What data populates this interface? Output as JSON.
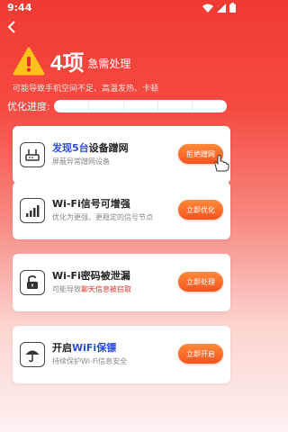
{
  "status": {
    "time": "9:44"
  },
  "hero": {
    "count": "4项",
    "count_label": "急需处理",
    "subtitle": "可能导致手机空间不足、高温发热、卡顿"
  },
  "progress": {
    "label": "优化进度:",
    "value": 0.0,
    "segments": 5
  },
  "cards": [
    {
      "title_hl": "发现5台",
      "title_rest": "设备蹭网",
      "desc_pre": "屏蔽异常蹭网设备",
      "desc_red": "",
      "desc_post": "",
      "button": "拒绝蹭网",
      "icon": "router-icon"
    },
    {
      "title_hl": "",
      "title_rest": "Wi-Fi信号可增强",
      "desc_pre": "优化为更强、更稳定的信号节点",
      "desc_red": "",
      "desc_post": "",
      "button": "立即优化",
      "icon": "signal-bars-icon"
    },
    {
      "title_hl": "",
      "title_rest": "Wi-Fi密码被泄漏",
      "desc_pre": "可能导致",
      "desc_red": "聊天信息被窃取",
      "desc_post": "",
      "button": "立即处理",
      "icon": "unlocked-padlock-icon"
    },
    {
      "title_hl": "WiFi保镖",
      "title_pre": "开启",
      "title_rest": "",
      "desc_pre": "持续保护Wi-Fi信息安全",
      "desc_red": "",
      "desc_post": "",
      "button": "立即开启",
      "icon": "umbrella-icon"
    }
  ],
  "colors": {
    "accent": "#f03a33",
    "button": "#f4531e",
    "highlight": "#2b4ed8"
  }
}
